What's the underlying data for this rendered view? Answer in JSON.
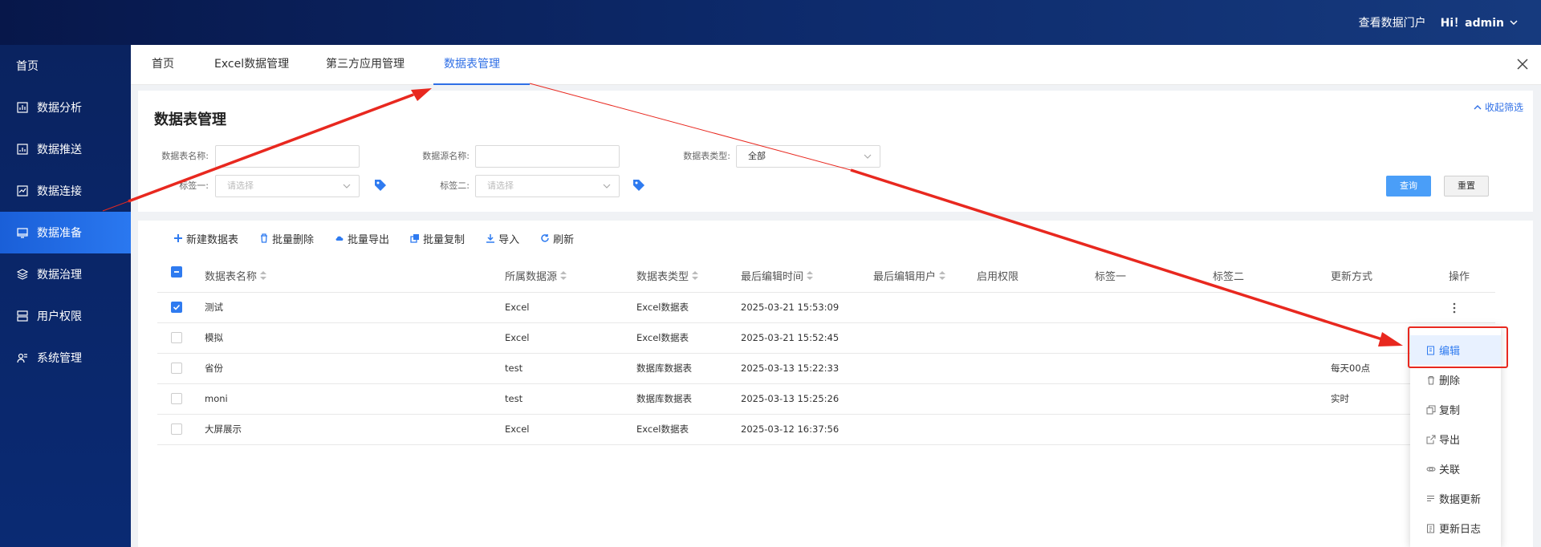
{
  "topbar": {
    "portal_link": "查看数据门户",
    "greeting": "Hi！admin"
  },
  "sidebar": {
    "home": "首页",
    "items": [
      {
        "label": "数据分析",
        "icon": "chart-icon"
      },
      {
        "label": "数据推送",
        "icon": "bar-chart-icon"
      },
      {
        "label": "数据连接",
        "icon": "connect-icon"
      },
      {
        "label": "数据准备",
        "icon": "monitor-icon",
        "active": true
      },
      {
        "label": "数据治理",
        "icon": "layers-icon"
      },
      {
        "label": "用户权限",
        "icon": "server-icon"
      },
      {
        "label": "系统管理",
        "icon": "users-icon"
      }
    ]
  },
  "tabs": [
    {
      "label": "首页"
    },
    {
      "label": "Excel数据管理"
    },
    {
      "label": "第三方应用管理"
    },
    {
      "label": "数据表管理",
      "active": true
    }
  ],
  "filter": {
    "title": "数据表管理",
    "collapse": "收起筛选",
    "table_name_label": "数据表名称:",
    "table_name_value": "",
    "source_name_label": "数据源名称:",
    "source_name_value": "",
    "type_label": "数据表类型:",
    "type_value": "全部",
    "tag1_label": "标签一:",
    "tag1_placeholder": "请选择",
    "tag2_label": "标签二:",
    "tag2_placeholder": "请选择",
    "query": "查询",
    "reset": "重置"
  },
  "toolbar": {
    "new": "新建数据表",
    "batch_delete": "批量删除",
    "batch_export": "批量导出",
    "batch_copy": "批量复制",
    "import": "导入",
    "refresh": "刷新"
  },
  "table": {
    "headers": [
      "数据表名称",
      "所属数据源",
      "数据表类型",
      "最后编辑时间",
      "最后编辑用户",
      "启用权限",
      "标签一",
      "标签二",
      "更新方式",
      "操作"
    ],
    "rows": [
      {
        "checked": true,
        "name": "测试",
        "source": "Excel",
        "type": "Excel数据表",
        "time": "2025-03-21 15:53:09",
        "user": "",
        "perm": "",
        "tag1": "",
        "tag2": "",
        "update": ""
      },
      {
        "checked": false,
        "name": "模拟",
        "source": "Excel",
        "type": "Excel数据表",
        "time": "2025-03-21 15:52:45",
        "user": "",
        "perm": "",
        "tag1": "",
        "tag2": "",
        "update": ""
      },
      {
        "checked": false,
        "name": "省份",
        "source": "test",
        "type": "数据库数据表",
        "time": "2025-03-13 15:22:33",
        "user": "",
        "perm": "",
        "tag1": "",
        "tag2": "",
        "update": "每天00点"
      },
      {
        "checked": false,
        "name": "moni",
        "source": "test",
        "type": "数据库数据表",
        "time": "2025-03-13 15:25:26",
        "user": "",
        "perm": "",
        "tag1": "",
        "tag2": "",
        "update": "实时"
      },
      {
        "checked": false,
        "name": "大屏展示",
        "source": "Excel",
        "type": "Excel数据表",
        "time": "2025-03-12 16:37:56",
        "user": "",
        "perm": "",
        "tag1": "",
        "tag2": "",
        "update": ""
      }
    ]
  },
  "menu": [
    {
      "label": "编辑",
      "icon": "edit-icon"
    },
    {
      "label": "删除",
      "icon": "trash-icon"
    },
    {
      "label": "复制",
      "icon": "copy-icon"
    },
    {
      "label": "导出",
      "icon": "export-icon"
    },
    {
      "label": "关联",
      "icon": "link-icon"
    },
    {
      "label": "数据更新",
      "icon": "list-icon"
    },
    {
      "label": "更新日志",
      "icon": "log-icon"
    }
  ],
  "colors": {
    "accent": "#2f6fe6",
    "annotation": "#e8281f",
    "sidebar": "#0a2360"
  }
}
